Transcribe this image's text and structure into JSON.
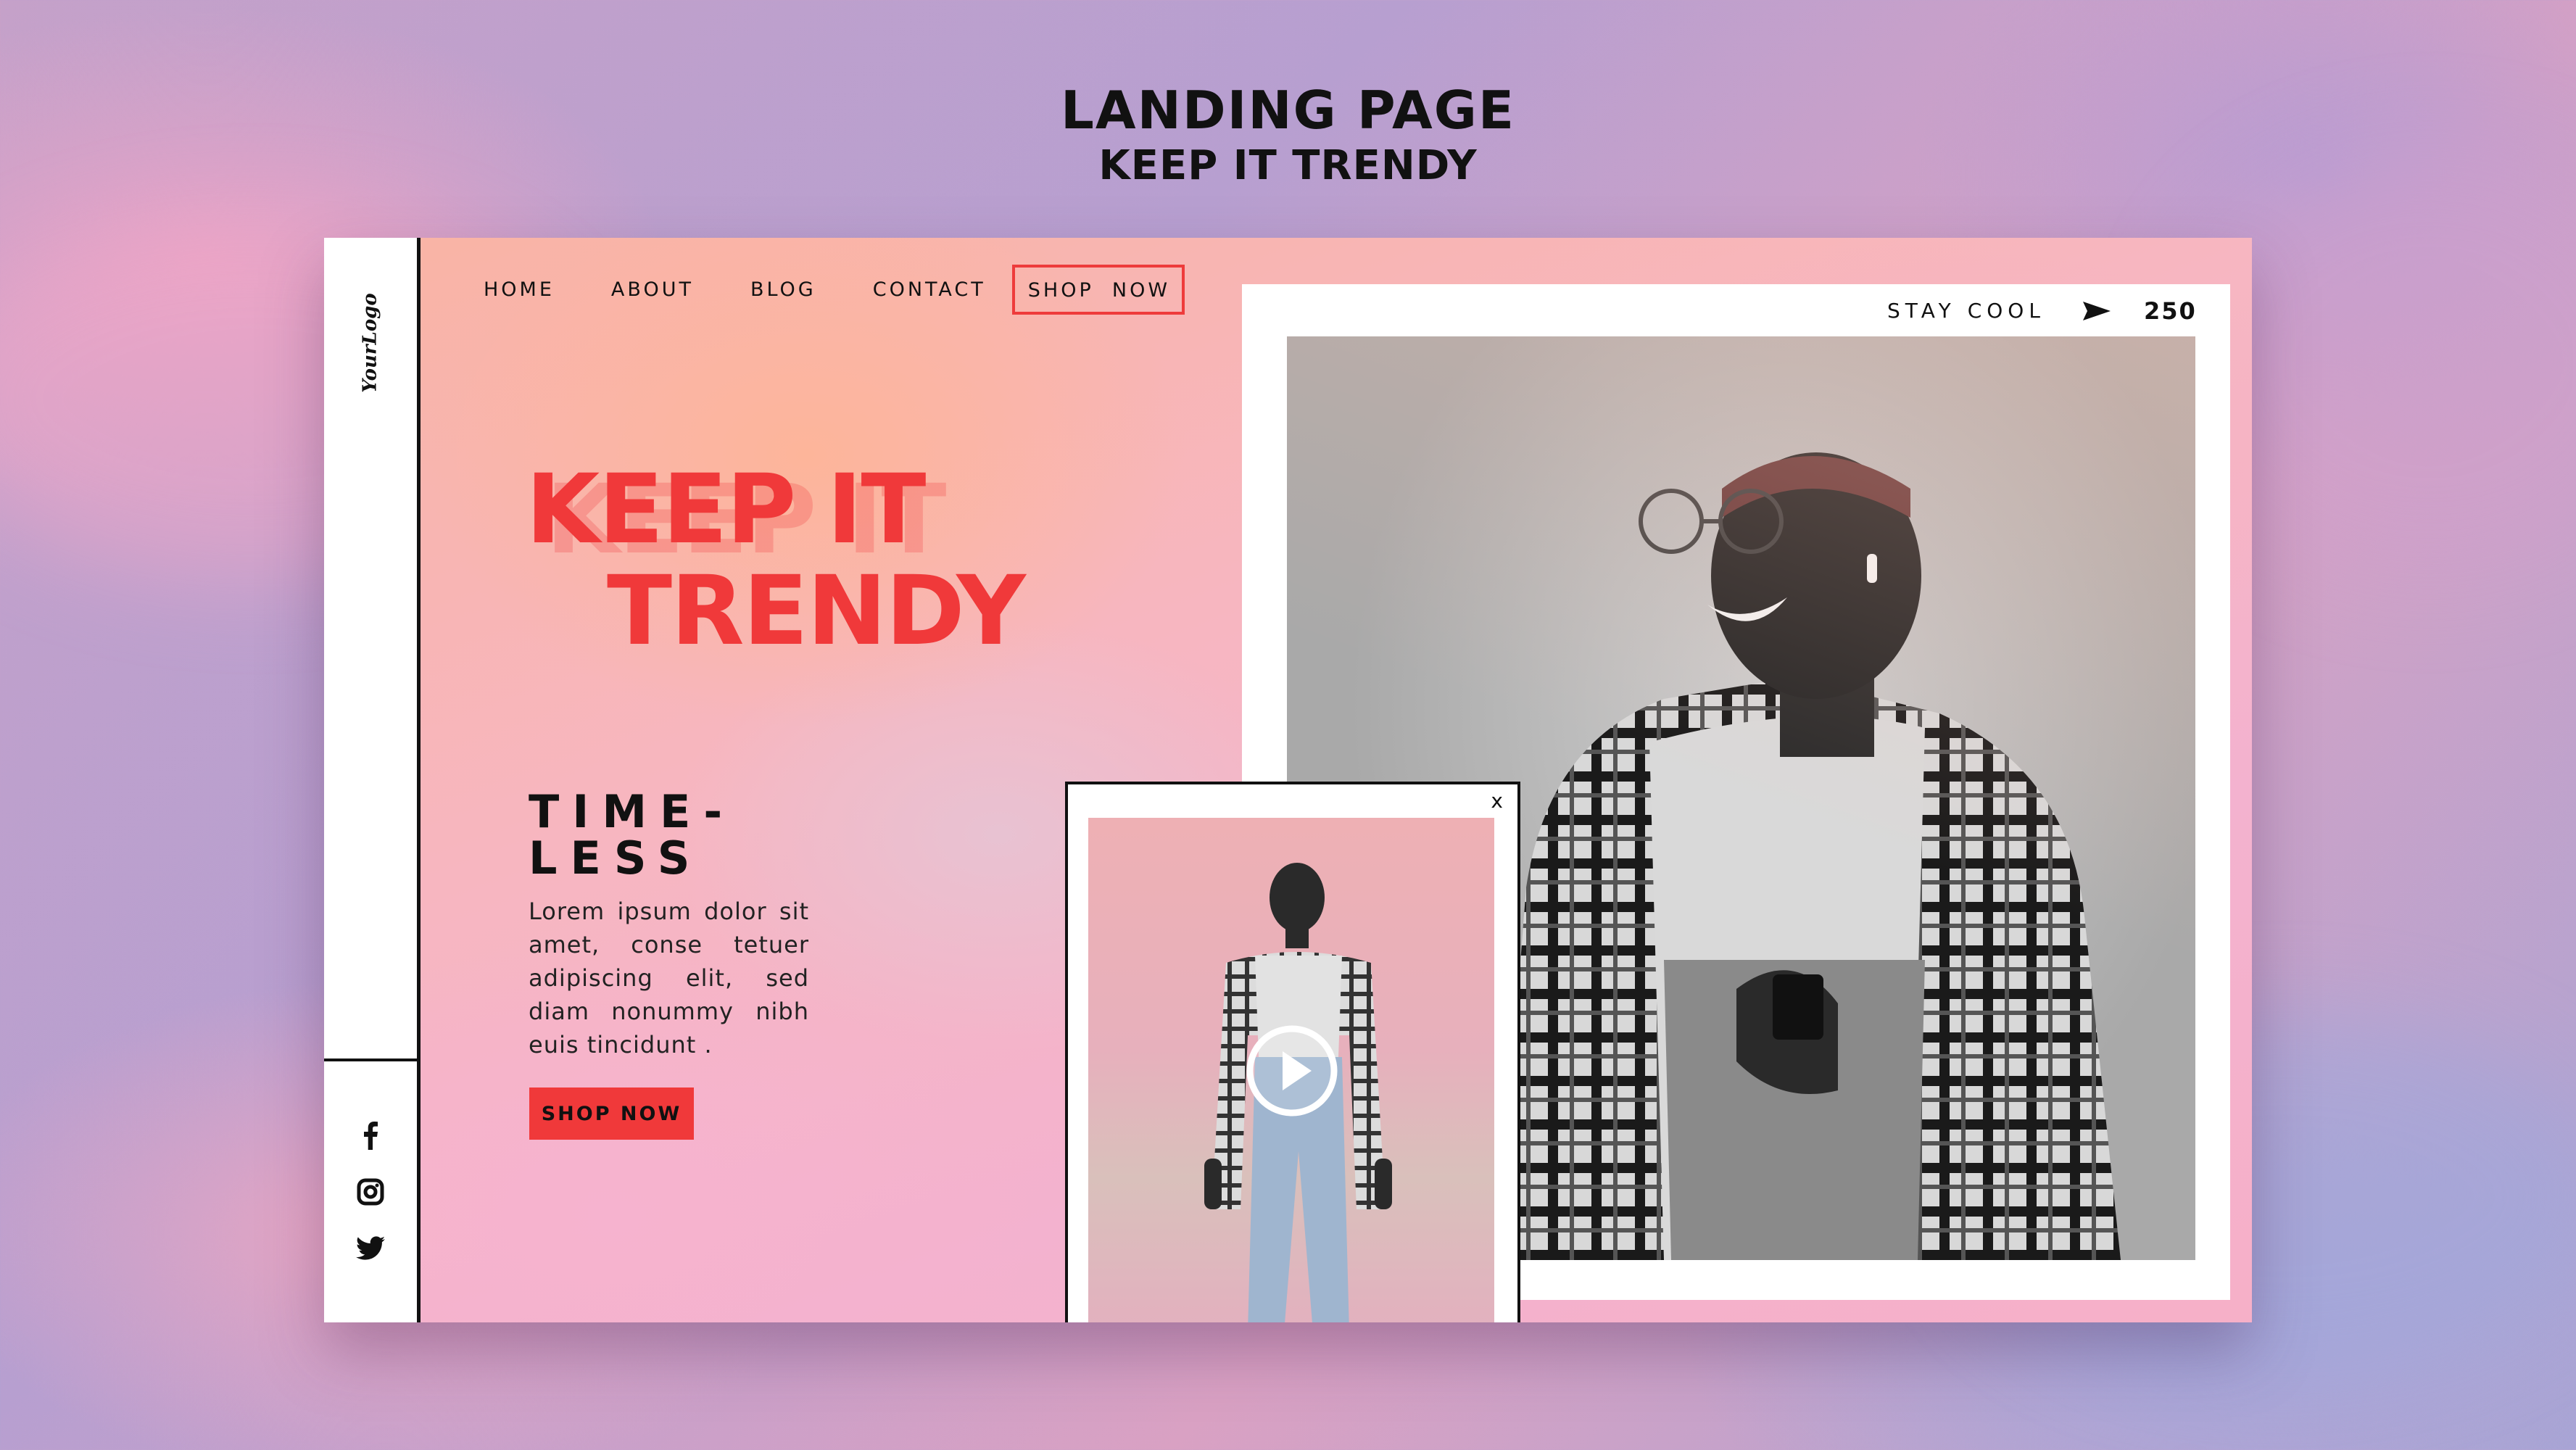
{
  "header": {
    "title": "LANDING PAGE",
    "subtitle": "KEEP IT TRENDY"
  },
  "sidebar": {
    "logo": "YourLogo",
    "social": [
      {
        "icon": "facebook-icon"
      },
      {
        "icon": "instagram-icon"
      },
      {
        "icon": "twitter-icon"
      }
    ]
  },
  "nav": {
    "items": [
      "HOME",
      "ABOUT",
      "BLOG",
      "CONTACT"
    ],
    "shop": "SHOP  NOW"
  },
  "hero": {
    "line1": "KEEP IT",
    "line2": "TRENDY"
  },
  "section": {
    "title_1": "TIME-",
    "title_2": "LESS",
    "body": "Lorem ipsum dolor sit amet, conse tetuer adipiscing elit, sed diam nonummy nibh euis tincidunt .",
    "cta": "SHOP NOW"
  },
  "frame": {
    "label": "STAY COOL",
    "count": "250"
  },
  "popup": {
    "close": "x"
  },
  "colors": {
    "accent": "#f0393a",
    "ink": "#111111"
  }
}
